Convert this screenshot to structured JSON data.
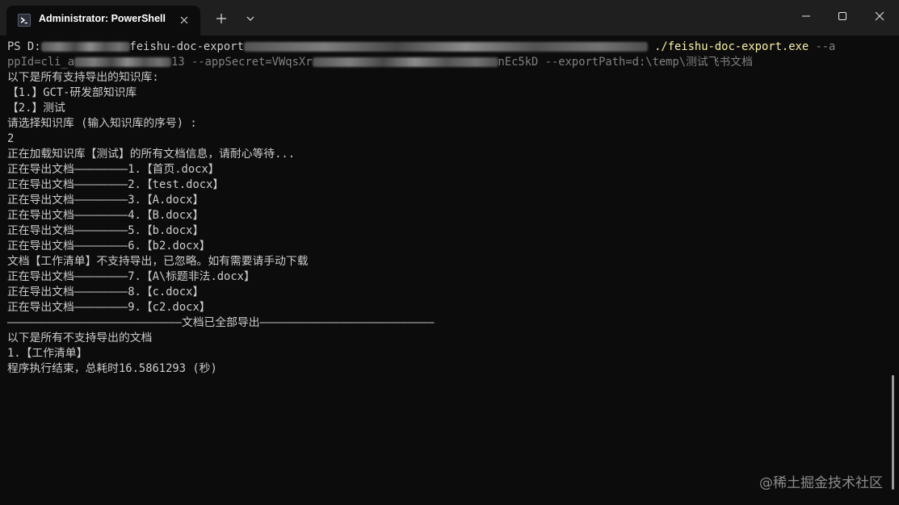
{
  "tab": {
    "title": "Administrator: PowerShell",
    "icon": "powershell-icon"
  },
  "toolbar": {
    "new_tab_icon": "plus-icon",
    "dropdown_icon": "chevron-down-icon"
  },
  "window_controls": {
    "minimize_icon": "minimize-icon",
    "maximize_icon": "maximize-icon",
    "close_icon": "close-icon"
  },
  "command": {
    "prompt": "PS D:",
    "path_part": "feishu-doc-export",
    "exe": "./feishu-doc-export.exe",
    "arg1": " --a",
    "line2_a": "ppId=cli_a",
    "line2_b": "13 --appSecret=VWqsXr",
    "line2_c": "nEc5kD --exportPath=d:\\temp\\测试飞书文档"
  },
  "output_lines": [
    "以下是所有支持导出的知识库:",
    "【1.】GCT-研发部知识库",
    "【2.】测试",
    "请选择知识库 (输入知识库的序号) :",
    "2",
    "正在加载知识库【测试】的所有文档信息，请耐心等待...",
    "正在导出文档————————1.【首页.docx】",
    "正在导出文档————————2.【test.docx】",
    "正在导出文档————————3.【A.docx】",
    "正在导出文档————————4.【B.docx】",
    "正在导出文档————————5.【b.docx】",
    "正在导出文档————————6.【b2.docx】",
    "文档【工作清单】不支持导出，已忽略。如有需要请手动下载",
    "正在导出文档————————7.【A\\标题非法.docx】",
    "正在导出文档————————8.【c.docx】",
    "正在导出文档————————9.【c2.docx】",
    "——————————————————————————文档已全部导出——————————————————————————",
    "以下是所有不支持导出的文档",
    "1.【工作清单】",
    "程序执行结束，总耗时16.5861293 (秒)"
  ],
  "watermark": "@稀土掘金技术社区",
  "colors": {
    "background": "#0c0c0c",
    "titlebar": "#1f1f1f",
    "text": "#cccccc",
    "exe": "#f9f1a5",
    "args": "#808080"
  }
}
